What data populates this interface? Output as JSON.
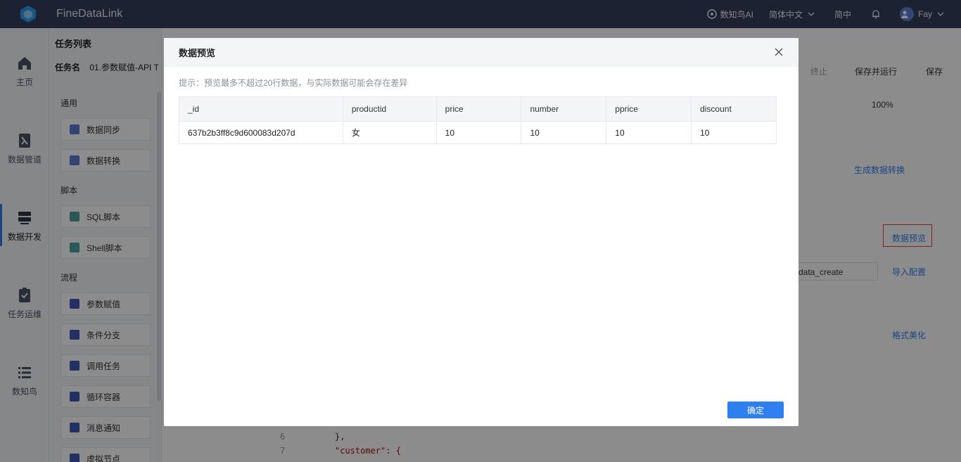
{
  "topbar": {
    "app_title": "FineDataLink",
    "ai_label": "数知鸟AI",
    "language": "简体中文",
    "simp": "简中",
    "user": "Fay"
  },
  "leftnav": {
    "items": [
      {
        "label": "主页",
        "icon": "home-icon"
      },
      {
        "label": "数据管道",
        "icon": "pipeline-icon"
      },
      {
        "label": "数据开发",
        "icon": "dev-icon"
      },
      {
        "label": "任务运维",
        "icon": "ops-icon"
      },
      {
        "label": "数知鸟",
        "icon": "list-icon"
      }
    ]
  },
  "taskpanel": {
    "title": "任务列表",
    "sections": [
      {
        "title": "通用",
        "tools": [
          "数据同步",
          "数据转换"
        ]
      },
      {
        "title": "脚本",
        "tools": [
          "SQL脚本",
          "Shell脚本"
        ]
      },
      {
        "title": "流程",
        "tools": [
          "参数赋值",
          "条件分支",
          "调用任务",
          "循环容器",
          "消息通知",
          "虚拟节点"
        ]
      }
    ]
  },
  "background": {
    "task_name_label": "任务名",
    "task_name_value": "01.参数赋值-API T",
    "stop": "终止",
    "save_run": "保存并运行",
    "save": "保存",
    "zoom": "100%",
    "gen_transform": "生成数据转换",
    "data_preview": "数据预览",
    "input_value": "data_create",
    "import_config": "导入配置",
    "format": "格式美化",
    "code_lines": [
      {
        "num": "6",
        "text": "},"
      },
      {
        "num": "7",
        "text": "\"customer\": {"
      }
    ]
  },
  "modal": {
    "title": "数据预览",
    "hint": "提示：预览最多不超过20行数据，与实际数据可能会存在差异",
    "columns": [
      "_id",
      "productid",
      "price",
      "number",
      "pprice",
      "discount"
    ],
    "rows": [
      [
        "637b2b3ff8c9d600083d207d",
        "女",
        "10",
        "10",
        "10",
        "10"
      ]
    ],
    "ok_label": "确定"
  }
}
